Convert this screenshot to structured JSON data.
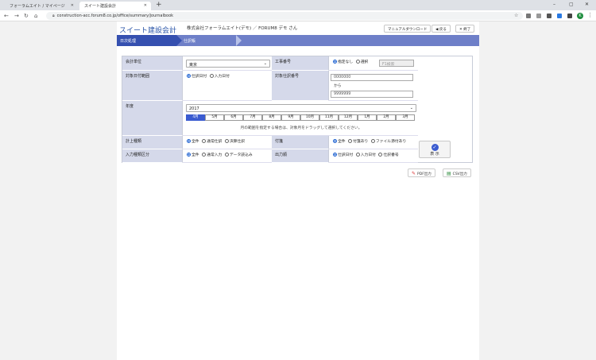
{
  "browser": {
    "tabs": [
      {
        "label": "フォーラムエイト / マイページ"
      },
      {
        "label": "スイート建設会計"
      }
    ],
    "url": "construction-acc.forum8.co.jp/office/summary/journalbook"
  },
  "header": {
    "app_title": "スイート建設会計",
    "company": "株式会社フォーラムエイト(デモ) ／ FORUM8 デモ さん",
    "manual_btn": "マニュアルダウンロード",
    "back_btn": "戻る",
    "exit_btn": "終了"
  },
  "breadcrumb": {
    "step1": "日次処理",
    "step2": "仕訳帳"
  },
  "form": {
    "accounting_unit": {
      "label": "会計単位",
      "value": "東京"
    },
    "construction_no": {
      "label": "工事番号",
      "opt_none": "指定なし",
      "opt_select": "選択",
      "placeholder": "F1検索"
    },
    "date_range": {
      "label": "対象日付範囲",
      "opt1": "仕訳日付",
      "opt2": "入力日付"
    },
    "journal_no": {
      "label": "対象仕訳番号",
      "from": "0000000",
      "sep": "から",
      "to": "9999999"
    },
    "fiscal_year": {
      "label": "年度",
      "value": "2017"
    },
    "months": [
      "4月",
      "5月",
      "6月",
      "7月",
      "8月",
      "9月",
      "10月",
      "11月",
      "12月",
      "1月",
      "2月",
      "3月"
    ],
    "month_hint": "月の範囲を指定する場合は、対象月をドラッグして選択してください。",
    "entry_type": {
      "label": "計上種類",
      "opt1": "全件",
      "opt2": "通常仕訳",
      "opt3": "決算仕訳"
    },
    "attachment": {
      "label": "付箋",
      "opt1": "全件",
      "opt2": "付箋あり",
      "opt3": "ファイル添付あり"
    },
    "input_type": {
      "label": "入力種類区分",
      "opt1": "全件",
      "opt2": "通常入力",
      "opt3": "データ読込み"
    },
    "output_order": {
      "label": "出力順",
      "opt1": "仕訳日付",
      "opt2": "入力日付",
      "opt3": "仕訳番号"
    },
    "show_btn": "表 示"
  },
  "export": {
    "pdf": "PDF出力",
    "csv": "CSV出力"
  }
}
